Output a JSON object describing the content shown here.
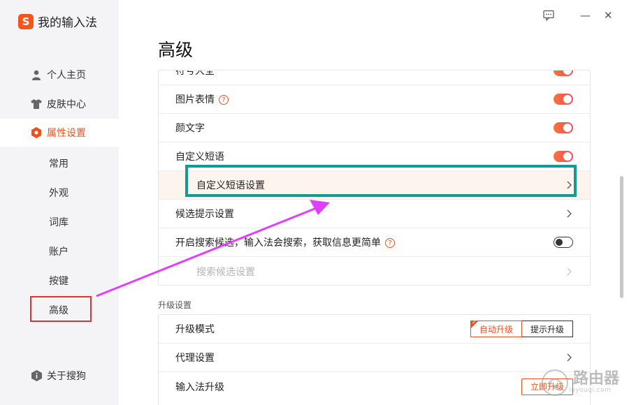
{
  "app": {
    "logo_letter": "S",
    "title": "我的输入法"
  },
  "window_controls": {
    "feedback": "feedback-icon",
    "minimize": "—",
    "close": "✕"
  },
  "sidebar": {
    "items": [
      {
        "label": "个人主页",
        "icon": "user-icon"
      },
      {
        "label": "皮肤中心",
        "icon": "shirt-icon"
      },
      {
        "label": "属性设置",
        "icon": "hexagon-icon"
      }
    ],
    "sub_items": [
      "常用",
      "外观",
      "词库",
      "账户",
      "按键",
      "高级"
    ],
    "about": "关于搜狗"
  },
  "main": {
    "title": "高级",
    "rows": [
      {
        "label": "符号大全",
        "control": "toggle-on"
      },
      {
        "label": "图片表情",
        "control": "toggle-on",
        "help": "?"
      },
      {
        "label": "颜文字",
        "control": "toggle-on"
      },
      {
        "label": "自定义短语",
        "control": "toggle-on"
      },
      {
        "label": "自定义短语设置",
        "control": "chevron"
      },
      {
        "label": "候选提示设置",
        "control": "chevron"
      },
      {
        "label": "开启搜索候选，输入法会搜索，获取信息更简单",
        "control": "toggle-off",
        "help": "?"
      },
      {
        "label": "搜索候选设置",
        "control": "chevron"
      }
    ],
    "upgrade_section": {
      "heading": "升级设置",
      "mode_label": "升级模式",
      "mode_options": [
        "自动升级",
        "提示升级"
      ],
      "selected": "自动升级",
      "proxy_label": "代理设置",
      "ime_upgrade_label": "输入法升级",
      "ime_upgrade_button": "立即升级"
    }
  },
  "watermark": {
    "text": "路由器",
    "sub": "luyouqi.com"
  },
  "colors": {
    "accent": "#e8541f",
    "teal_annotation": "#0e9c95",
    "red_annotation": "#e0322f",
    "arrow": "#e040fb"
  }
}
